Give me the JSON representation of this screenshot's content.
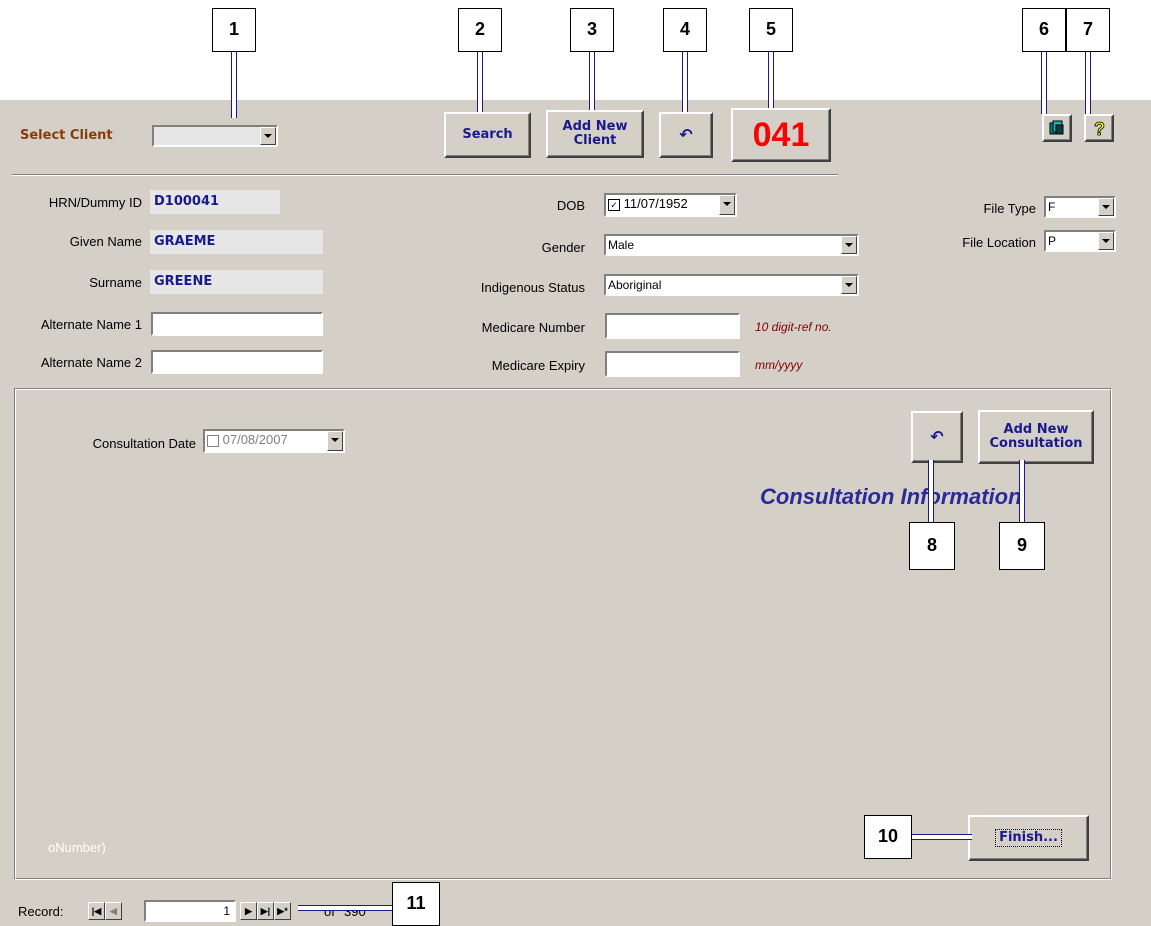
{
  "callouts": [
    "1",
    "2",
    "3",
    "4",
    "5",
    "6",
    "7",
    "8",
    "9",
    "10",
    "11"
  ],
  "header": {
    "select_client_label": "Select Client",
    "select_client_value": "",
    "search_label": "Search",
    "add_new_client_label": "Add New\nClient",
    "undo_symbol": "↶",
    "record_code": "041"
  },
  "client": {
    "hrn_label": "HRN/Dummy ID",
    "hrn_value": "D100041",
    "given_label": "Given Name",
    "given_value": "GRAEME",
    "surname_label": "Surname",
    "surname_value": "GREENE",
    "alt1_label": "Alternate Name 1",
    "alt1_value": "",
    "alt2_label": "Alternate Name 2",
    "alt2_value": "",
    "dob_label": "DOB",
    "dob_value": "11/07/1952",
    "gender_label": "Gender",
    "gender_value": "Male",
    "indigenous_label": "Indigenous Status",
    "indigenous_value": "Aboriginal",
    "medicare_number_label": "Medicare Number",
    "medicare_number_value": "",
    "medicare_number_hint": "10 digit-ref no.",
    "medicare_expiry_label": "Medicare Expiry",
    "medicare_expiry_value": "",
    "medicare_expiry_hint": "mm/yyyy",
    "file_type_label": "File Type",
    "file_type_value": "F",
    "file_location_label": "File Location",
    "file_location_value": "P"
  },
  "consultation": {
    "date_label": "Consultation Date",
    "date_value": "07/08/2007",
    "undo_symbol": "↶",
    "add_new_label": "Add New\nConsultation",
    "section_title": "Consultation Information",
    "footer_fragment": "oNumber)",
    "finish_label": "Finish..."
  },
  "record_nav": {
    "label": "Record:",
    "current": "1",
    "of_label": "of",
    "total": "390"
  },
  "colors": {
    "form_bg": "#d4d0c8",
    "value_text": "#1a1a8c",
    "record_code": "#ff0000",
    "select_client_label": "#8b3a0a",
    "hint": "#800000"
  }
}
